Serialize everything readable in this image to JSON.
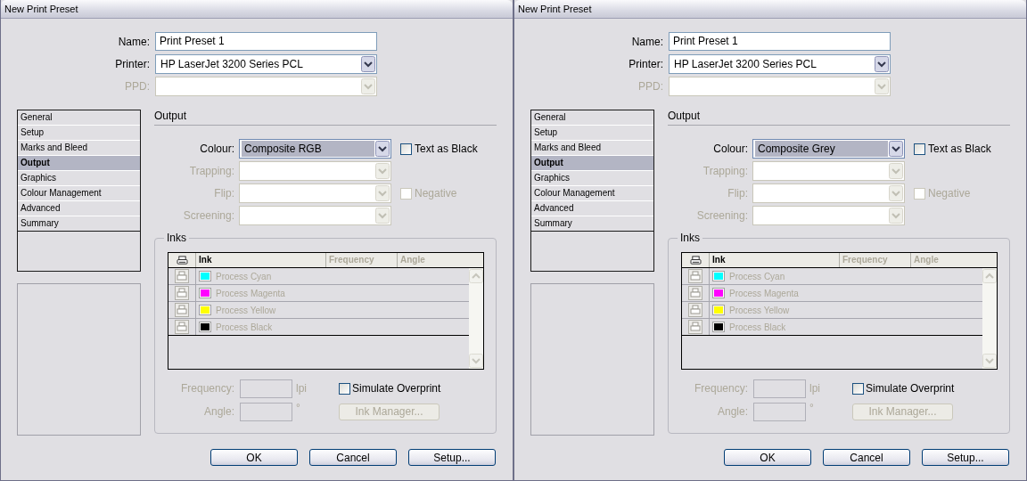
{
  "dialogs": [
    {
      "title": "New Print Preset",
      "top_fields": [
        {
          "kind": "text",
          "label": "Name:",
          "value": "Print Preset 1",
          "disabled": false
        },
        {
          "kind": "select",
          "label": "Printer:",
          "value": "HP LaserJet 3200 Series PCL",
          "disabled": false
        },
        {
          "kind": "select",
          "label": "PPD:",
          "disabled": true
        }
      ],
      "sections": [
        {
          "label": "General",
          "selected": false
        },
        {
          "label": "Setup",
          "selected": false
        },
        {
          "label": "Marks and Bleed",
          "selected": false
        },
        {
          "label": "Output",
          "selected": true
        },
        {
          "label": "Graphics",
          "selected": false
        },
        {
          "label": "Colour Management",
          "selected": false
        },
        {
          "label": "Advanced",
          "selected": false
        },
        {
          "label": "Summary",
          "selected": false
        }
      ],
      "panel_title": "Output",
      "output_fields": [
        {
          "label": "Colour:",
          "value": "Composite RGB",
          "disabled": false,
          "checkbox": {
            "label": "Text as Black",
            "checked": false,
            "disabled": false
          }
        },
        {
          "label": "Trapping:",
          "disabled": true
        },
        {
          "label": "Flip:",
          "disabled": true,
          "checkbox": {
            "label": "Negative",
            "checked": false,
            "disabled": true
          }
        },
        {
          "label": "Screening:",
          "disabled": true
        }
      ],
      "inks": {
        "title": "Inks",
        "columns": [
          {
            "label": "Ink",
            "disabled": false
          },
          {
            "label": "Frequency",
            "disabled": true
          },
          {
            "label": "Angle",
            "disabled": true
          }
        ],
        "rows": [
          {
            "name": "Process Cyan",
            "color": "#00ffff",
            "disabled": true
          },
          {
            "name": "Process Magenta",
            "color": "#ff00ff",
            "disabled": true
          },
          {
            "name": "Process Yellow",
            "color": "#ffff00",
            "disabled": true
          },
          {
            "name": "Process Black",
            "color": "#000000",
            "disabled": true
          }
        ],
        "frequency": {
          "label": "Frequency:",
          "unit": "lpi",
          "disabled": true
        },
        "angle": {
          "label": "Angle:",
          "unit": "°",
          "disabled": true
        },
        "simulate_overprint": {
          "label": "Simulate Overprint",
          "checked": false,
          "disabled": false
        },
        "ink_manager": {
          "label": "Ink Manager...",
          "disabled": true
        }
      },
      "buttons": [
        "OK",
        "Cancel",
        "Setup..."
      ]
    },
    {
      "title": "New Print Preset",
      "top_fields": [
        {
          "kind": "text",
          "label": "Name:",
          "value": "Print Preset 1",
          "disabled": false
        },
        {
          "kind": "select",
          "label": "Printer:",
          "value": "HP LaserJet 3200 Series PCL",
          "disabled": false
        },
        {
          "kind": "select",
          "label": "PPD:",
          "disabled": true
        }
      ],
      "sections": [
        {
          "label": "General",
          "selected": false
        },
        {
          "label": "Setup",
          "selected": false
        },
        {
          "label": "Marks and Bleed",
          "selected": false
        },
        {
          "label": "Output",
          "selected": true
        },
        {
          "label": "Graphics",
          "selected": false
        },
        {
          "label": "Colour Management",
          "selected": false
        },
        {
          "label": "Advanced",
          "selected": false
        },
        {
          "label": "Summary",
          "selected": false
        }
      ],
      "panel_title": "Output",
      "output_fields": [
        {
          "label": "Colour:",
          "value": "Composite Grey",
          "disabled": false,
          "checkbox": {
            "label": "Text as Black",
            "checked": false,
            "disabled": false
          }
        },
        {
          "label": "Trapping:",
          "disabled": true
        },
        {
          "label": "Flip:",
          "disabled": true,
          "checkbox": {
            "label": "Negative",
            "checked": false,
            "disabled": true
          }
        },
        {
          "label": "Screening:",
          "disabled": true
        }
      ],
      "inks": {
        "title": "Inks",
        "columns": [
          {
            "label": "Ink",
            "disabled": false
          },
          {
            "label": "Frequency",
            "disabled": true
          },
          {
            "label": "Angle",
            "disabled": true
          }
        ],
        "rows": [
          {
            "name": "Process Cyan",
            "color": "#00ffff",
            "disabled": true
          },
          {
            "name": "Process Magenta",
            "color": "#ff00ff",
            "disabled": true
          },
          {
            "name": "Process Yellow",
            "color": "#ffff00",
            "disabled": true
          },
          {
            "name": "Process Black",
            "color": "#000000",
            "disabled": true
          }
        ],
        "frequency": {
          "label": "Frequency:",
          "unit": "lpi",
          "disabled": true
        },
        "angle": {
          "label": "Angle:",
          "unit": "°",
          "disabled": true
        },
        "simulate_overprint": {
          "label": "Simulate Overprint",
          "checked": false,
          "disabled": false
        },
        "ink_manager": {
          "label": "Ink Manager...",
          "disabled": true
        }
      },
      "buttons": [
        "OK",
        "Cancel",
        "Setup..."
      ]
    }
  ]
}
